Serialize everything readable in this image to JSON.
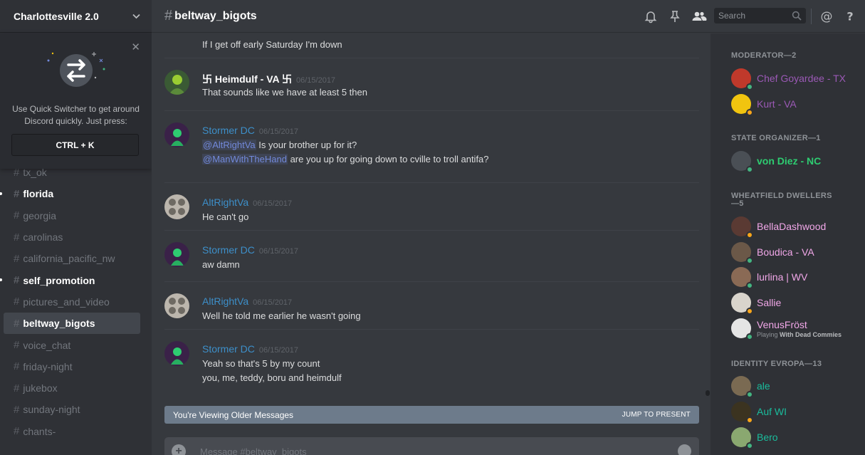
{
  "server": {
    "name": "Charlottesville 2.0"
  },
  "quick_switcher": {
    "text": "Use Quick Switcher to get around Discord quickly. Just press:",
    "shortcut": "CTRL + K"
  },
  "channels": [
    {
      "name": "tx_ok",
      "state": "normal"
    },
    {
      "name": "florida",
      "state": "unread"
    },
    {
      "name": "georgia",
      "state": "normal"
    },
    {
      "name": "carolinas",
      "state": "normal"
    },
    {
      "name": "california_pacific_nw",
      "state": "normal"
    },
    {
      "name": "self_promotion",
      "state": "unread"
    },
    {
      "name": "pictures_and_video",
      "state": "normal"
    },
    {
      "name": "beltway_bigots",
      "state": "active"
    },
    {
      "name": "voice_chat",
      "state": "normal"
    },
    {
      "name": "friday-night",
      "state": "normal"
    },
    {
      "name": "jukebox",
      "state": "normal"
    },
    {
      "name": "sunday-night",
      "state": "normal"
    },
    {
      "name": "chants-",
      "state": "normal"
    }
  ],
  "topbar": {
    "channel": "beltway_bigots",
    "search_placeholder": "Search"
  },
  "messages": [
    {
      "author": "",
      "timestamp": "",
      "lines": [
        [
          {
            "t": "If I get off early Saturday I'm down"
          }
        ]
      ]
    },
    {
      "author": "卐 Heimdulf - VA 卐",
      "timestamp": "06/15/2017",
      "style": "white",
      "lines": [
        [
          {
            "t": "That sounds like we have at least 5 then"
          }
        ]
      ]
    },
    {
      "author": "Stormer DC",
      "timestamp": "06/15/2017",
      "style": "blue",
      "lines": [
        [
          {
            "t": "@AltRightVa",
            "m": true
          },
          {
            "t": " Is your brother up for it?"
          }
        ],
        [
          {
            "t": "@ManWithTheHand",
            "m": true
          },
          {
            "t": "  are you up for going down to cville to troll antifa?"
          }
        ]
      ]
    },
    {
      "author": "AltRightVa",
      "timestamp": "06/15/2017",
      "style": "blue",
      "lines": [
        [
          {
            "t": "He can't go"
          }
        ]
      ]
    },
    {
      "author": "Stormer DC",
      "timestamp": "06/15/2017",
      "style": "blue",
      "lines": [
        [
          {
            "t": "aw damn"
          }
        ]
      ]
    },
    {
      "author": "AltRightVa",
      "timestamp": "06/15/2017",
      "style": "blue",
      "lines": [
        [
          {
            "t": "Well he told me earlier he wasn't going"
          }
        ]
      ]
    },
    {
      "author": "Stormer DC",
      "timestamp": "06/15/2017",
      "style": "blue",
      "lines": [
        [
          {
            "t": "Yeah so that's 5 by my count"
          }
        ],
        [
          {
            "t": "you, me, teddy, boru and heimdulf"
          }
        ]
      ]
    }
  ],
  "older_bar": {
    "text": "You're Viewing Older Messages",
    "jump": "JUMP TO PRESENT"
  },
  "composer": {
    "placeholder": "Message #beltway_bigots"
  },
  "member_groups": [
    {
      "title": "MODERATOR—2"
    },
    {
      "title": "STATE ORGANIZER—1"
    },
    {
      "title": "WHEATFIELD DWELLERS—5"
    },
    {
      "title": "IDENTITY EVROPA—13"
    }
  ],
  "members": [
    {
      "name": "Chef Goyardee - TX",
      "color": "purple",
      "status": "online",
      "avatar": "#c0392b"
    },
    {
      "name": "Kurt - VA",
      "color": "purple",
      "status": "idle",
      "avatar": "#f1c40f"
    },
    {
      "name": "von Diez - NC",
      "color": "green",
      "status": "online",
      "avatar": "#4a4f55"
    },
    {
      "name": "BellaDashwood",
      "color": "pink",
      "status": "idle",
      "avatar": "#5a3a33"
    },
    {
      "name": "Boudica - VA",
      "color": "pink",
      "status": "online",
      "avatar": "#6b5848"
    },
    {
      "name": "lurlina | WV",
      "color": "pink",
      "status": "online",
      "avatar": "#8a6a55"
    },
    {
      "name": "Sallie",
      "color": "pink",
      "status": "idle",
      "avatar": "#d9d4cc"
    },
    {
      "name": "VenusFröst",
      "color": "pink",
      "status": "online",
      "avatar": "#e5e5e5",
      "playing": "Playing",
      "game": "With Dead Commies"
    },
    {
      "name": "ale",
      "color": "teal",
      "status": "online",
      "avatar": "#7a6a52"
    },
    {
      "name": "Auf WI",
      "color": "teal",
      "status": "idle",
      "avatar": "#3b3320"
    },
    {
      "name": "Bero",
      "color": "teal",
      "status": "online",
      "avatar": "#8aa870"
    }
  ],
  "colors": {
    "online": "#43b581",
    "idle": "#faa61a"
  }
}
